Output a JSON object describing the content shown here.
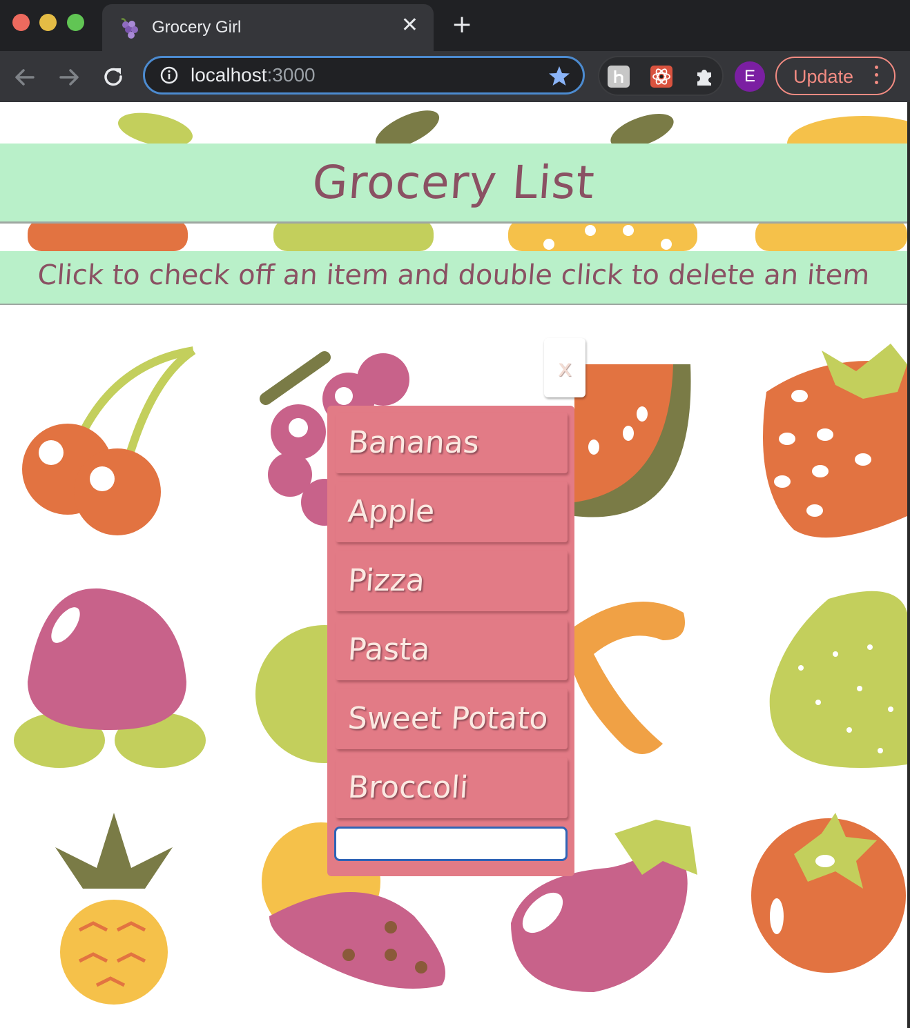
{
  "browser": {
    "tab_title": "Grocery Girl",
    "tab_close": "✕",
    "new_tab": "+",
    "url_host": "localhost",
    "url_port": ":3000",
    "avatar_initial": "E",
    "update_label": "Update",
    "accent": "#4c8bd0",
    "update_color": "#f28b82"
  },
  "header": {
    "title": "Grocery List",
    "instructions": "Click to check off an item and double click to delete an item"
  },
  "list": {
    "close_label": "x",
    "items": [
      {
        "label": "Bananas"
      },
      {
        "label": "Apple"
      },
      {
        "label": "Pizza"
      },
      {
        "label": "Pasta"
      },
      {
        "label": "Sweet Potato"
      },
      {
        "label": "Broccoli"
      }
    ],
    "input_value": "",
    "input_placeholder": ""
  },
  "colors": {
    "band_green": "#b9f0c9",
    "title_text": "#8a5163",
    "panel_pink": "#e27b86"
  },
  "icons": [
    "grapes-favicon-icon",
    "back-arrow-icon",
    "forward-arrow-icon",
    "reload-icon",
    "info-icon",
    "star-icon",
    "extension-h-icon",
    "extension-react-icon",
    "puzzle-icon",
    "kebab-menu-icon"
  ]
}
